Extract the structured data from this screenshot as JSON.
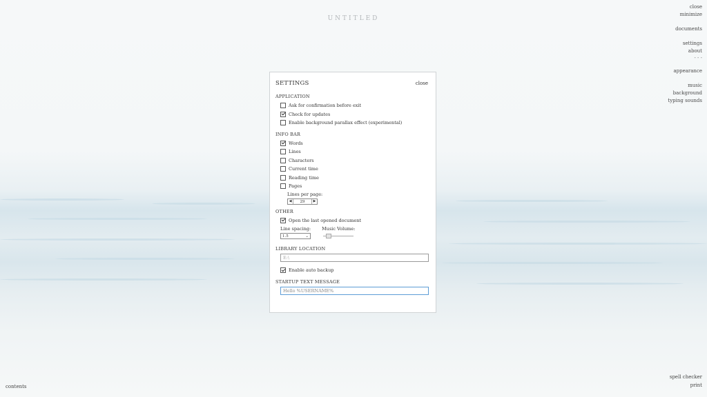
{
  "doc_title": "UNTITLED",
  "right_menu": {
    "close": "close",
    "minimize": "minimize",
    "documents": "documents",
    "settings": "settings",
    "about": "about",
    "dots": "- - -",
    "appearance": "appearance",
    "music": "music",
    "background": "background",
    "typing_sounds": "typing sounds"
  },
  "bottom_left": {
    "contents": "contents"
  },
  "bottom_right": {
    "spell_checker": "spell checker",
    "print": "print"
  },
  "settings": {
    "title": "SETTINGS",
    "close": "close",
    "application": {
      "title": "APPLICATION",
      "items": [
        {
          "label": "Ask for confirmation before exit",
          "checked": false
        },
        {
          "label": "Check for updates",
          "checked": true
        },
        {
          "label": "Enable background parallax effect (experimental)",
          "checked": false
        }
      ]
    },
    "info_bar": {
      "title": "INFO BAR",
      "items": [
        {
          "label": "Words",
          "checked": true
        },
        {
          "label": "Lines",
          "checked": false
        },
        {
          "label": "Characters",
          "checked": false
        },
        {
          "label": "Current time",
          "checked": false
        },
        {
          "label": "Reading time",
          "checked": false
        },
        {
          "label": "Pages",
          "checked": false
        }
      ],
      "lines_per_page_label": "Lines per page:",
      "lines_per_page_value": "29"
    },
    "other": {
      "title": "OTHER",
      "open_last": {
        "label": "Open the last opened document",
        "checked": true
      },
      "line_spacing_label": "Line spacing:",
      "line_spacing_value": "1.5",
      "music_volume_label": "Music Volume:"
    },
    "library": {
      "title": "LIBRARY LOCATION",
      "path_value": "E:\\",
      "auto_backup": {
        "label": "Enable auto backup",
        "checked": true
      }
    },
    "startup": {
      "title": "STARTUP TEXT MESSAGE",
      "value": "Hello %USERNAME%"
    }
  }
}
